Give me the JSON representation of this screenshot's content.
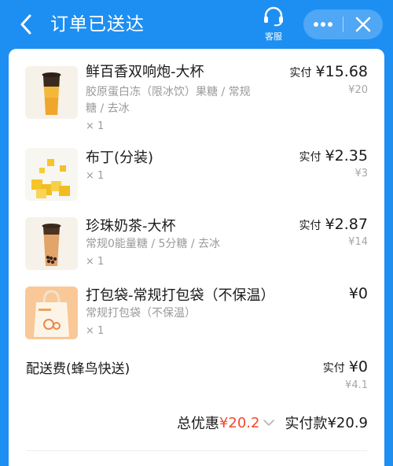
{
  "header": {
    "title": "订单已送达",
    "service_label": "客服",
    "back_icon": "chevron-left-icon",
    "more_icon": "more-dots-icon",
    "close_icon": "close-icon",
    "bg_color": "#1e8ff2"
  },
  "items": [
    {
      "name": "鲜百香双响炮-大杯",
      "spec_line1": "胶原蛋白冻（限冰饮）果糖 / 常规",
      "spec_line2": "糖 / 去冰",
      "qty": "× 1",
      "paid_label": "实付",
      "paid_value": "¥15.68",
      "original": "¥20",
      "thumb": "passion-fruit-drink"
    },
    {
      "name": "布丁(分装)",
      "qty": "× 1",
      "paid_label": "实付",
      "paid_value": "¥2.35",
      "original": "¥3",
      "thumb": "pudding-cubes"
    },
    {
      "name": "珍珠奶茶-大杯",
      "spec_line1": "常规0能量糖 / 5分糖 / 去冰",
      "qty": "× 1",
      "paid_label": "实付",
      "paid_value": "¥2.87",
      "original": "¥14",
      "thumb": "pearl-milk-tea"
    },
    {
      "name": "打包袋-常规打包袋（不保温）",
      "spec_line1": "常规打包袋（不保温）",
      "qty": "× 1",
      "paid_value": "¥0",
      "thumb": "packing-bag"
    }
  ],
  "delivery": {
    "label": "配送费(蜂鸟快送)",
    "paid_label": "实付",
    "paid_value": "¥0",
    "original": "¥4.1"
  },
  "summary": {
    "discount_label": "总优惠",
    "discount_value": "¥20.2",
    "paid_label": "实付款",
    "paid_value": "¥20.9",
    "accent_color": "#ef4a2c"
  }
}
